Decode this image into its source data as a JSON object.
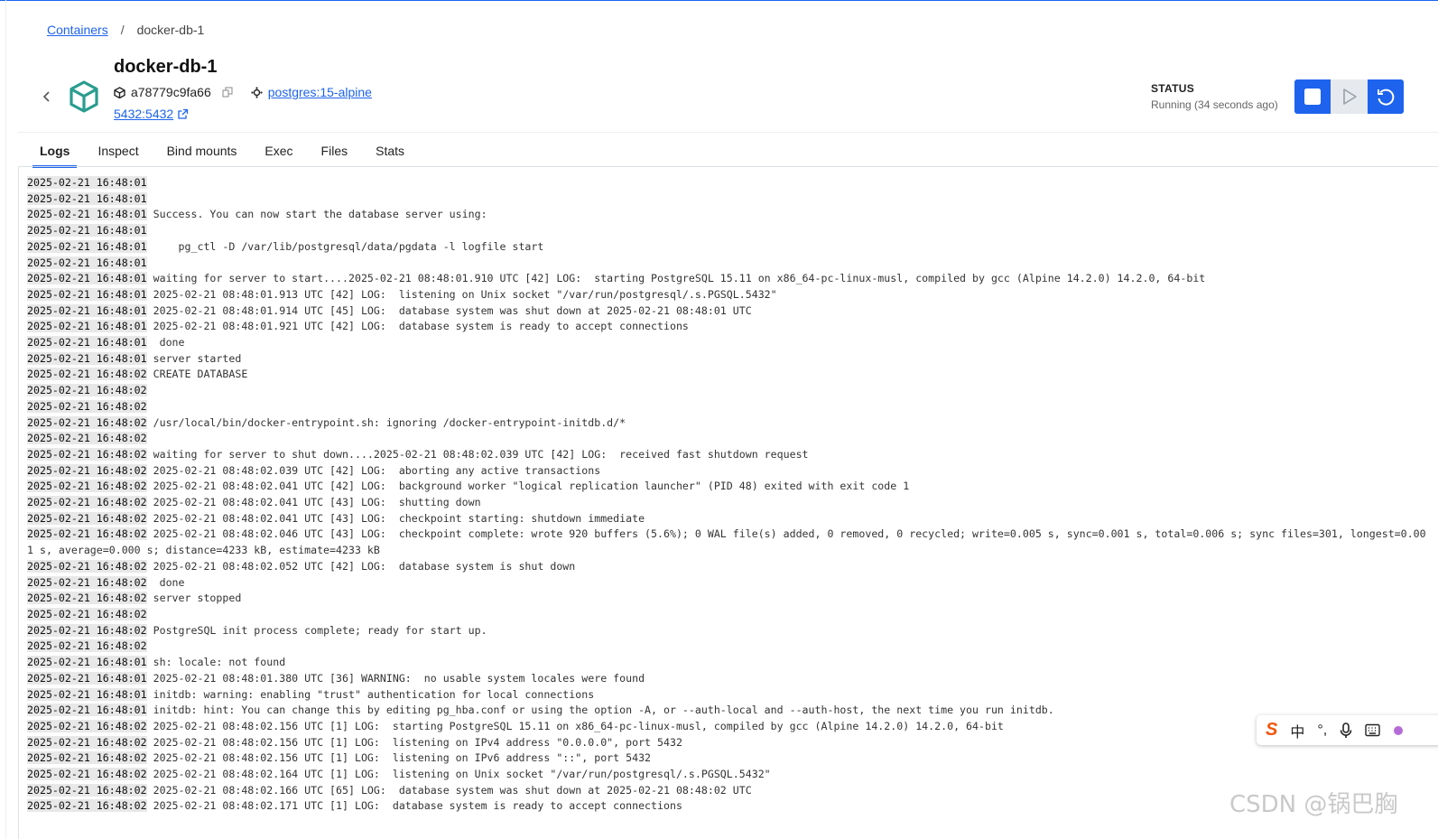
{
  "breadcrumb": {
    "root": "Containers",
    "separator": "/",
    "current": "docker-db-1"
  },
  "container": {
    "name": "docker-db-1",
    "id": "a78779c9fa66",
    "image": "postgres:15-alpine",
    "ports": "5432:5432"
  },
  "status": {
    "label": "STATUS",
    "value": "Running (34 seconds ago)"
  },
  "icons": {
    "back": "chevron-left-icon",
    "container": "container-cube-icon",
    "copy": "copy-icon",
    "image": "image-icon",
    "external": "external-link-icon",
    "stop": "stop-icon",
    "start": "play-icon",
    "restart": "restart-icon"
  },
  "colors": {
    "accent": "#1d63ed",
    "timestamp_bg": "#e8e8e8",
    "cube": "#2a9d8f"
  },
  "tabs": [
    {
      "label": "Logs",
      "active": true
    },
    {
      "label": "Inspect",
      "active": false
    },
    {
      "label": "Bind mounts",
      "active": false
    },
    {
      "label": "Exec",
      "active": false
    },
    {
      "label": "Files",
      "active": false
    },
    {
      "label": "Stats",
      "active": false
    }
  ],
  "logs": [
    {
      "ts": "2025-02-21 16:48:01",
      "msg": ""
    },
    {
      "ts": "2025-02-21 16:48:01",
      "msg": ""
    },
    {
      "ts": "2025-02-21 16:48:01",
      "msg": "Success. You can now start the database server using:"
    },
    {
      "ts": "2025-02-21 16:48:01",
      "msg": ""
    },
    {
      "ts": "2025-02-21 16:48:01",
      "msg": "    pg_ctl -D /var/lib/postgresql/data/pgdata -l logfile start"
    },
    {
      "ts": "2025-02-21 16:48:01",
      "msg": ""
    },
    {
      "ts": "2025-02-21 16:48:01",
      "msg": "waiting for server to start....2025-02-21 08:48:01.910 UTC [42] LOG:  starting PostgreSQL 15.11 on x86_64-pc-linux-musl, compiled by gcc (Alpine 14.2.0) 14.2.0, 64-bit"
    },
    {
      "ts": "2025-02-21 16:48:01",
      "msg": "2025-02-21 08:48:01.913 UTC [42] LOG:  listening on Unix socket \"/var/run/postgresql/.s.PGSQL.5432\""
    },
    {
      "ts": "2025-02-21 16:48:01",
      "msg": "2025-02-21 08:48:01.914 UTC [45] LOG:  database system was shut down at 2025-02-21 08:48:01 UTC"
    },
    {
      "ts": "2025-02-21 16:48:01",
      "msg": "2025-02-21 08:48:01.921 UTC [42] LOG:  database system is ready to accept connections"
    },
    {
      "ts": "2025-02-21 16:48:01",
      "msg": " done"
    },
    {
      "ts": "2025-02-21 16:48:01",
      "msg": "server started"
    },
    {
      "ts": "2025-02-21 16:48:02",
      "msg": "CREATE DATABASE"
    },
    {
      "ts": "2025-02-21 16:48:02",
      "msg": ""
    },
    {
      "ts": "2025-02-21 16:48:02",
      "msg": ""
    },
    {
      "ts": "2025-02-21 16:48:02",
      "msg": "/usr/local/bin/docker-entrypoint.sh: ignoring /docker-entrypoint-initdb.d/*"
    },
    {
      "ts": "2025-02-21 16:48:02",
      "msg": ""
    },
    {
      "ts": "2025-02-21 16:48:02",
      "msg": "waiting for server to shut down....2025-02-21 08:48:02.039 UTC [42] LOG:  received fast shutdown request"
    },
    {
      "ts": "2025-02-21 16:48:02",
      "msg": "2025-02-21 08:48:02.039 UTC [42] LOG:  aborting any active transactions"
    },
    {
      "ts": "2025-02-21 16:48:02",
      "msg": "2025-02-21 08:48:02.041 UTC [42] LOG:  background worker \"logical replication launcher\" (PID 48) exited with exit code 1"
    },
    {
      "ts": "2025-02-21 16:48:02",
      "msg": "2025-02-21 08:48:02.041 UTC [43] LOG:  shutting down"
    },
    {
      "ts": "2025-02-21 16:48:02",
      "msg": "2025-02-21 08:48:02.041 UTC [43] LOG:  checkpoint starting: shutdown immediate"
    },
    {
      "ts": "2025-02-21 16:48:02",
      "msg": "2025-02-21 08:48:02.046 UTC [43] LOG:  checkpoint complete: wrote 920 buffers (5.6%); 0 WAL file(s) added, 0 removed, 0 recycled; write=0.005 s, sync=0.001 s, total=0.006 s; sync files=301, longest=0.001 s, average=0.000 s; distance=4233 kB, estimate=4233 kB"
    },
    {
      "ts": "2025-02-21 16:48:02",
      "msg": "2025-02-21 08:48:02.052 UTC [42] LOG:  database system is shut down"
    },
    {
      "ts": "2025-02-21 16:48:02",
      "msg": " done"
    },
    {
      "ts": "2025-02-21 16:48:02",
      "msg": "server stopped"
    },
    {
      "ts": "2025-02-21 16:48:02",
      "msg": ""
    },
    {
      "ts": "2025-02-21 16:48:02",
      "msg": "PostgreSQL init process complete; ready for start up."
    },
    {
      "ts": "2025-02-21 16:48:02",
      "msg": ""
    },
    {
      "ts": "2025-02-21 16:48:01",
      "msg": "sh: locale: not found"
    },
    {
      "ts": "2025-02-21 16:48:01",
      "msg": "2025-02-21 08:48:01.380 UTC [36] WARNING:  no usable system locales were found"
    },
    {
      "ts": "2025-02-21 16:48:01",
      "msg": "initdb: warning: enabling \"trust\" authentication for local connections"
    },
    {
      "ts": "2025-02-21 16:48:01",
      "msg": "initdb: hint: You can change this by editing pg_hba.conf or using the option -A, or --auth-local and --auth-host, the next time you run initdb."
    },
    {
      "ts": "2025-02-21 16:48:02",
      "msg": "2025-02-21 08:48:02.156 UTC [1] LOG:  starting PostgreSQL 15.11 on x86_64-pc-linux-musl, compiled by gcc (Alpine 14.2.0) 14.2.0, 64-bit"
    },
    {
      "ts": "2025-02-21 16:48:02",
      "msg": "2025-02-21 08:48:02.156 UTC [1] LOG:  listening on IPv4 address \"0.0.0.0\", port 5432"
    },
    {
      "ts": "2025-02-21 16:48:02",
      "msg": "2025-02-21 08:48:02.156 UTC [1] LOG:  listening on IPv6 address \"::\", port 5432"
    },
    {
      "ts": "2025-02-21 16:48:02",
      "msg": "2025-02-21 08:48:02.164 UTC [1] LOG:  listening on Unix socket \"/var/run/postgresql/.s.PGSQL.5432\""
    },
    {
      "ts": "2025-02-21 16:48:02",
      "msg": "2025-02-21 08:48:02.166 UTC [65] LOG:  database system was shut down at 2025-02-21 08:48:02 UTC"
    },
    {
      "ts": "2025-02-21 16:48:02",
      "msg": "2025-02-21 08:48:02.171 UTC [1] LOG:  database system is ready to accept connections"
    }
  ],
  "ime_toolbar": {
    "logo": "S",
    "lang": "中",
    "punct": "°,"
  },
  "watermark": "CSDN @锅巴胸"
}
